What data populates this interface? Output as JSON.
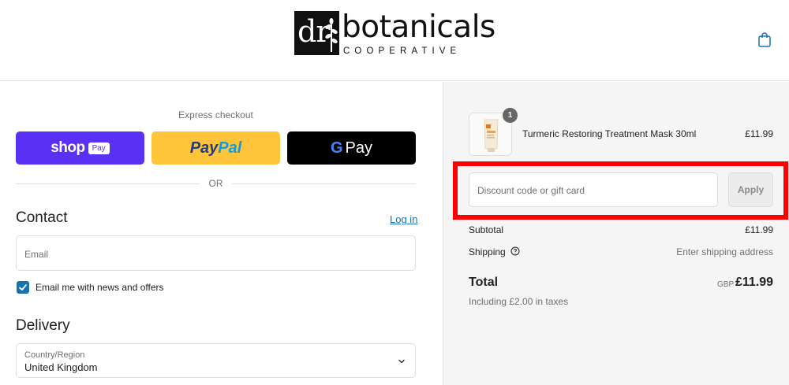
{
  "brand": {
    "logo_mark": "dr",
    "logo_name": "botanicals",
    "logo_sub": "COOPERATIVE"
  },
  "header": {
    "cart_icon": "shopping-bag-icon"
  },
  "express": {
    "title": "Express checkout",
    "shop_pay": {
      "brand": "shop",
      "pay": "Pay"
    },
    "paypal": {
      "part1": "Pay",
      "part2": "Pal"
    },
    "gpay": {
      "g": "G",
      "pay": "Pay"
    },
    "or": "OR"
  },
  "contact": {
    "title": "Contact",
    "login": "Log in",
    "email_placeholder": "Email",
    "newsletter_label": "Email me with news and offers",
    "newsletter_checked": true
  },
  "delivery": {
    "title": "Delivery",
    "country_label": "Country/Region",
    "country_value": "United Kingdom"
  },
  "summary": {
    "item": {
      "quantity": "1",
      "name": "Turmeric Restoring Treatment Mask 30ml",
      "price": "£11.99"
    },
    "discount_placeholder": "Discount code or gift card",
    "apply": "Apply",
    "subtotal_label": "Subtotal",
    "subtotal_value": "£11.99",
    "shipping_label": "Shipping",
    "shipping_value": "Enter shipping address",
    "total_label": "Total",
    "total_currency": "GBP",
    "total_value": "£11.99",
    "tax_note": "Including £2.00 in taxes"
  },
  "colors": {
    "accent": "#1773b0",
    "highlight": "#ff0000",
    "shop_pay": "#5a31f4",
    "paypal": "#ffc439"
  }
}
